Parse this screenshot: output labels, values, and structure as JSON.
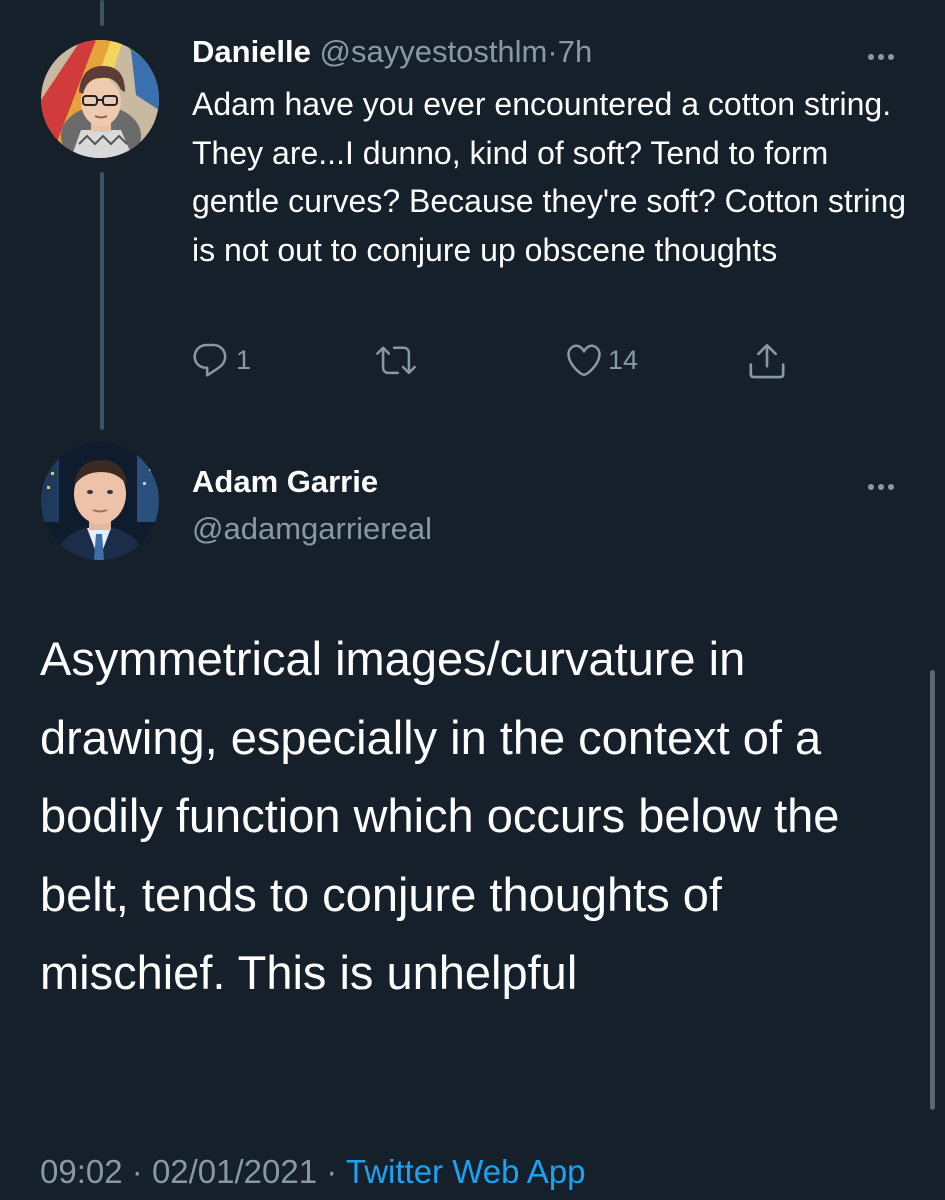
{
  "reply_tweet": {
    "display_name": "Danielle",
    "handle": "@sayyestosthlm",
    "separator": "·",
    "time": "7h",
    "text": "Adam have you ever encountered a cotton string. They are...I dunno, kind of soft? Tend to form gentle curves? Because they're soft? Cotton string is not out to conjure up obscene thoughts",
    "reply_count": "1",
    "retweet_count": "",
    "like_count": "14"
  },
  "main_tweet": {
    "display_name": "Adam Garrie",
    "handle": "@adamgarriereal",
    "text": "Asymmetrical images/curvature in drawing, especially in the context of a bodily function which occurs below the belt, tends to conjure thoughts of mischief. This is unhelpful",
    "time": "09:02",
    "date": "02/01/2021",
    "separator": "·",
    "source": "Twitter Web App"
  },
  "icons": {
    "more": "more-horizontal-icon",
    "reply": "reply-icon",
    "retweet": "retweet-icon",
    "like": "heart-icon",
    "share": "share-icon"
  },
  "colors": {
    "background": "#15202b",
    "text": "#ffffff",
    "muted": "#8899a6",
    "link": "#1da1f2",
    "thread_line": "#3d5466"
  }
}
